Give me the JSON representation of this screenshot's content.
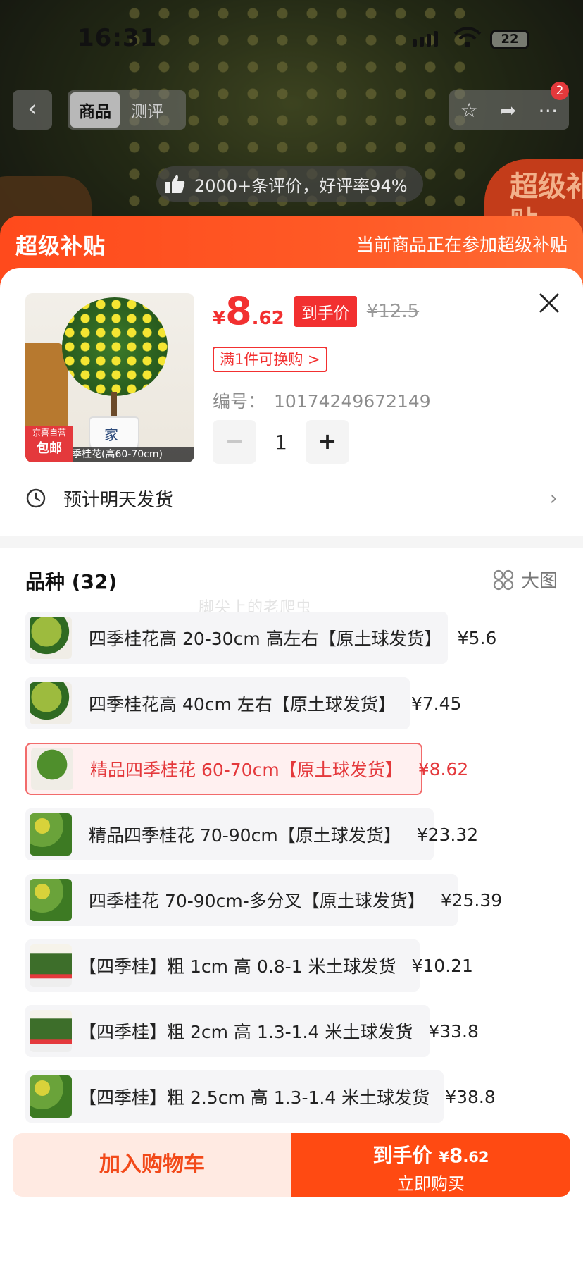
{
  "status_bar": {
    "time": "16:31",
    "battery": "22"
  },
  "top_nav": {
    "tabs": [
      {
        "label": "商品",
        "active": true
      },
      {
        "label": "测评",
        "active": false
      }
    ],
    "cart_badge": "2"
  },
  "review_pill": "2000+条评价，好评率94%",
  "side_tag": "超级补贴",
  "banner": {
    "title": "超级补贴",
    "desc": "当前商品正在参加超级补贴"
  },
  "product": {
    "image_caption": "季桂花(高60-70cm)",
    "image_tag_line1": "京喜自营",
    "image_tag_line2": "包邮",
    "pot_text": "家",
    "price_symbol": "¥",
    "price_int": "8",
    "price_dec": ".62",
    "final_price_tag": "到手价",
    "original_price": "¥12.5",
    "exchange_tag": "满1件可换购 >",
    "sku_label": "编号：",
    "sku_value": "10174249672149",
    "quantity": "1",
    "minus": "−",
    "plus": "+"
  },
  "shipping": {
    "label": "预计明天发货",
    "chevron": "›"
  },
  "variety": {
    "title": "品种 (32)",
    "big_view_label": "大图",
    "watermark": "脚尖上的老爬虫",
    "options": [
      {
        "label": "四季桂花高 20-30cm 高左右【原土球发货】",
        "price": "¥5.6",
        "selected": false
      },
      {
        "label": "四季桂花高 40cm 左右【原土球发货】",
        "price": "¥7.45",
        "selected": false
      },
      {
        "label": "精品四季桂花 60-70cm【原土球发货】",
        "price": "¥8.62",
        "selected": true
      },
      {
        "label": "精品四季桂花 70-90cm【原土球发货】",
        "price": "¥23.32",
        "selected": false
      },
      {
        "label": "四季桂花 70-90cm-多分叉【原土球发货】",
        "price": "¥25.39",
        "selected": false
      },
      {
        "label": "【四季桂】粗 1cm 高 0.8-1 米土球发货",
        "price": "¥10.21",
        "selected": false
      },
      {
        "label": "【四季桂】粗 2cm 高 1.3-1.4 米土球发货",
        "price": "¥33.8",
        "selected": false
      },
      {
        "label": "【四季桂】粗 2.5cm 高 1.3-1.4 米土球发货",
        "price": "¥38.8",
        "selected": false
      }
    ]
  },
  "bottom_bar": {
    "add_cart": "加入购物车",
    "buy_line1_prefix": "到手价",
    "buy_price_symbol": "¥",
    "buy_price_int": "8",
    "buy_price_dec": ".62",
    "buy_line2": "立即购买"
  },
  "colors": {
    "accent": "#ff4a12",
    "price_red": "#f23030",
    "banner": "#ff5a26"
  }
}
